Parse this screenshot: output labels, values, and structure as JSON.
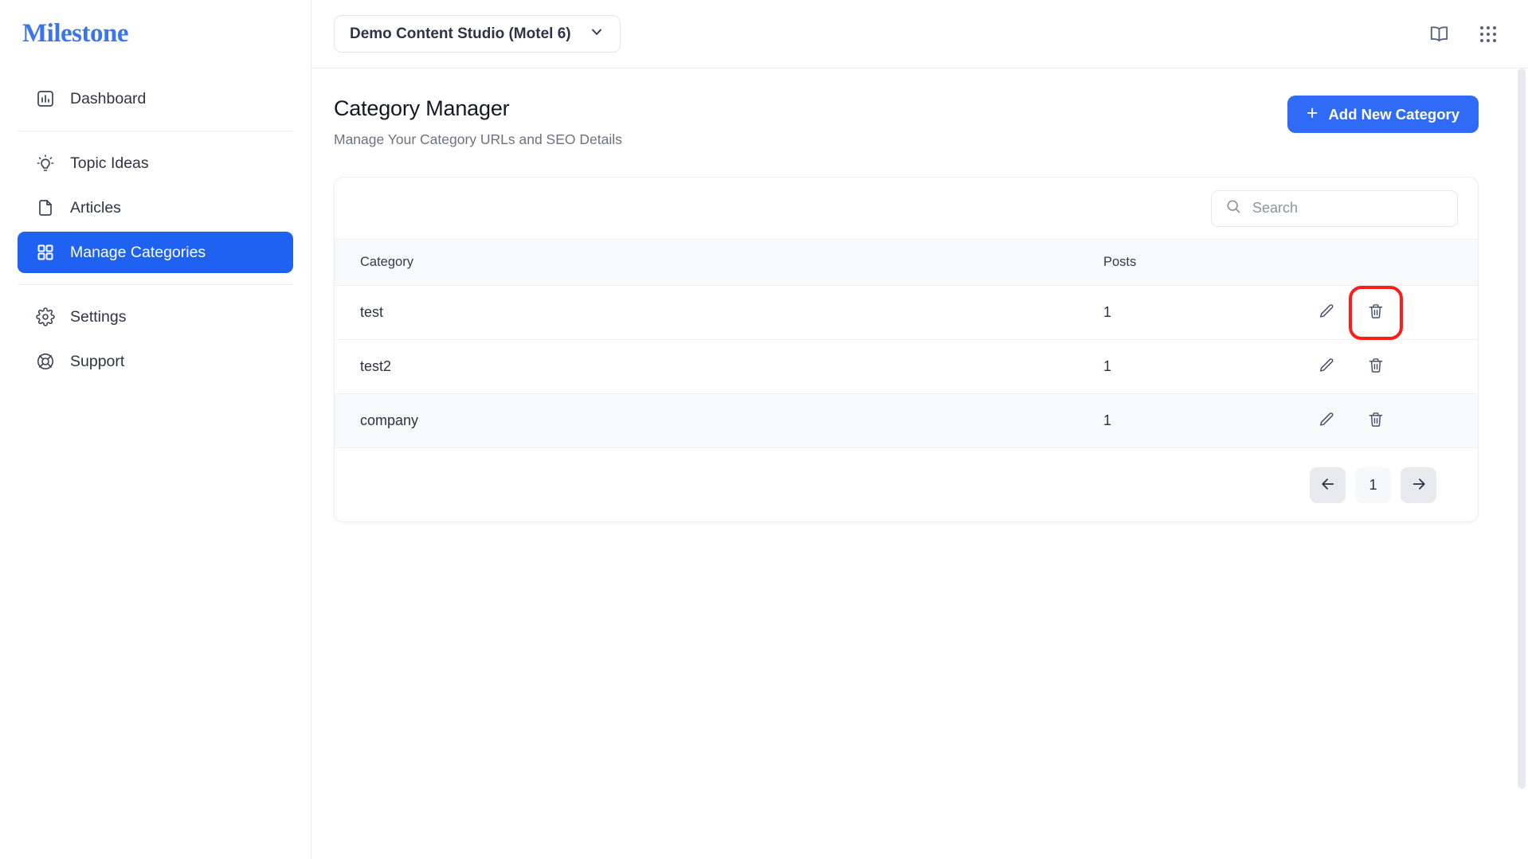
{
  "sidebar": {
    "logo": "Milestone",
    "items": [
      {
        "label": "Dashboard",
        "icon": "chart-bar-icon",
        "active": false
      },
      {
        "label": "Topic Ideas",
        "icon": "lightbulb-icon",
        "active": false
      },
      {
        "label": "Articles",
        "icon": "document-icon",
        "active": false
      },
      {
        "label": "Manage Categories",
        "icon": "grid-squares-icon",
        "active": true
      },
      {
        "label": "Settings",
        "icon": "gear-icon",
        "active": false
      },
      {
        "label": "Support",
        "icon": "lifebuoy-icon",
        "active": false
      }
    ]
  },
  "topbar": {
    "studio_selector": "Demo Content Studio (Motel 6)",
    "chevron_icon": "chevron-down-icon",
    "book_icon": "book-icon",
    "apps_icon": "apps-grid-icon"
  },
  "page": {
    "title": "Category Manager",
    "subtitle": "Manage Your Category URLs and SEO Details",
    "add_button": "Add New Category",
    "add_button_icon": "plus-icon"
  },
  "search": {
    "placeholder": "Search",
    "value": "",
    "icon": "search-icon"
  },
  "table": {
    "columns": [
      "Category",
      "Posts",
      ""
    ],
    "rows": [
      {
        "category": "test",
        "posts": "1",
        "edit_icon": "pencil-icon",
        "delete_icon": "trash-icon",
        "highlighted": true,
        "hover": false
      },
      {
        "category": "test2",
        "posts": "1",
        "edit_icon": "pencil-icon",
        "delete_icon": "trash-icon",
        "highlighted": false,
        "hover": false
      },
      {
        "category": "company",
        "posts": "1",
        "edit_icon": "pencil-icon",
        "delete_icon": "trash-icon",
        "highlighted": false,
        "hover": true
      }
    ]
  },
  "pagination": {
    "prev_icon": "arrow-left-icon",
    "page": "1",
    "next_icon": "arrow-right-icon"
  },
  "colors": {
    "brand_blue": "#3b74ef",
    "accent_blue": "#2f6bf6",
    "active_nav": "#1f62f2",
    "highlight_red": "#fd1d1d",
    "header_bg": "#f8f9fb",
    "text_primary": "#2b3242",
    "text_muted": "#6b7280"
  }
}
